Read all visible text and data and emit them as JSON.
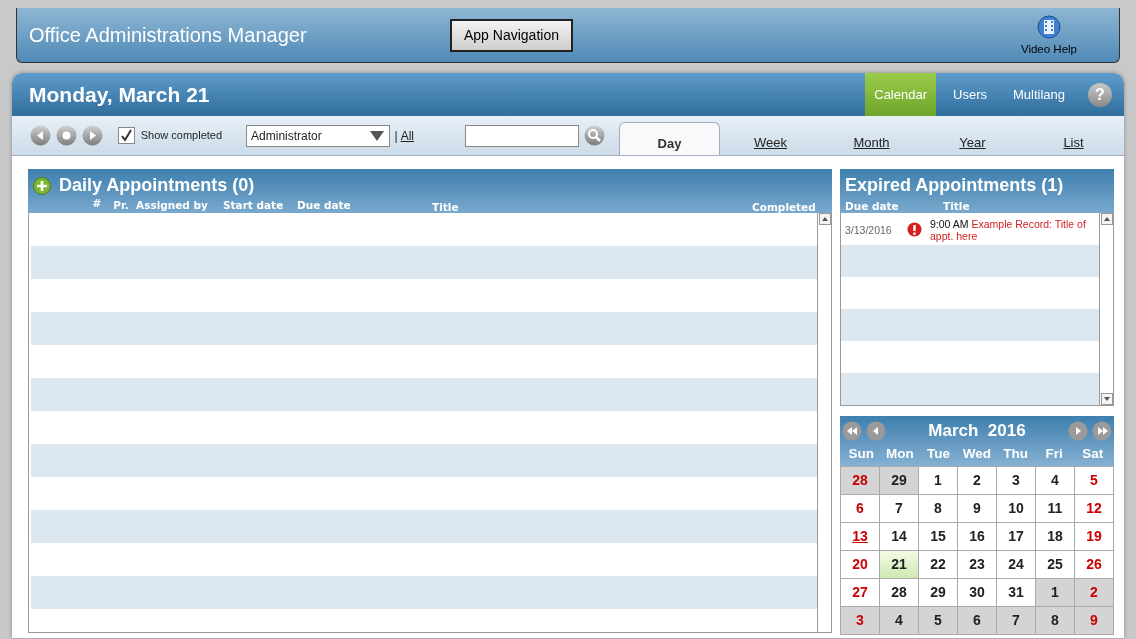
{
  "app": {
    "title": "Office Administrations Manager",
    "nav_button": "App Navigation",
    "video_help": "Video Help"
  },
  "header": {
    "date": "Monday, March 21",
    "help": "?",
    "nav": [
      {
        "label": "Calendar",
        "selected": true
      },
      {
        "label": "Users",
        "selected": false
      },
      {
        "label": "Multilang",
        "selected": false
      }
    ]
  },
  "toolbar": {
    "show_completed": {
      "label": "Show completed",
      "checked": true
    },
    "assignee": "Administrator",
    "separator": "|",
    "all_link": "All"
  },
  "view_tabs": [
    {
      "label": "Day",
      "selected": true
    },
    {
      "label": "Week",
      "selected": false
    },
    {
      "label": "Month",
      "selected": false
    },
    {
      "label": "Year",
      "selected": false
    },
    {
      "label": "List",
      "selected": false
    }
  ],
  "daily": {
    "title": "Daily Appointments (0)",
    "columns": [
      "#",
      "Pr.",
      "Assigned by",
      "Start date",
      "Due date",
      "Title",
      "Completed"
    ]
  },
  "expired": {
    "title": "Expired Appointments (1)",
    "columns": [
      "Due date",
      "Title"
    ],
    "rows": [
      {
        "due": "3/13/2016",
        "time": "9:00 AM",
        "title": "Example Record: Title of appt. here"
      }
    ]
  },
  "calendar": {
    "title": "March  2016",
    "weekdays": [
      "Sun",
      "Mon",
      "Tue",
      "Wed",
      "Thu",
      "Fri",
      "Sat"
    ],
    "weeks": [
      [
        {
          "day": "28",
          "outside": true,
          "selected": false,
          "event": false
        },
        {
          "day": "29",
          "outside": true,
          "selected": false,
          "event": false
        },
        {
          "day": "1",
          "outside": false,
          "selected": false,
          "event": false
        },
        {
          "day": "2",
          "outside": false,
          "selected": false,
          "event": false
        },
        {
          "day": "3",
          "outside": false,
          "selected": false,
          "event": false
        },
        {
          "day": "4",
          "outside": false,
          "selected": false,
          "event": false
        },
        {
          "day": "5",
          "outside": false,
          "selected": false,
          "event": false
        }
      ],
      [
        {
          "day": "6",
          "outside": false,
          "selected": false,
          "event": false
        },
        {
          "day": "7",
          "outside": false,
          "selected": false,
          "event": false
        },
        {
          "day": "8",
          "outside": false,
          "selected": false,
          "event": false
        },
        {
          "day": "9",
          "outside": false,
          "selected": false,
          "event": false
        },
        {
          "day": "10",
          "outside": false,
          "selected": false,
          "event": false
        },
        {
          "day": "11",
          "outside": false,
          "selected": false,
          "event": false
        },
        {
          "day": "12",
          "outside": false,
          "selected": false,
          "event": false
        }
      ],
      [
        {
          "day": "13",
          "outside": false,
          "selected": false,
          "event": true
        },
        {
          "day": "14",
          "outside": false,
          "selected": false,
          "event": false
        },
        {
          "day": "15",
          "outside": false,
          "selected": false,
          "event": false
        },
        {
          "day": "16",
          "outside": false,
          "selected": false,
          "event": false
        },
        {
          "day": "17",
          "outside": false,
          "selected": false,
          "event": false
        },
        {
          "day": "18",
          "outside": false,
          "selected": false,
          "event": false
        },
        {
          "day": "19",
          "outside": false,
          "selected": false,
          "event": false
        }
      ],
      [
        {
          "day": "20",
          "outside": false,
          "selected": false,
          "event": false
        },
        {
          "day": "21",
          "outside": false,
          "selected": true,
          "event": false
        },
        {
          "day": "22",
          "outside": false,
          "selected": false,
          "event": false
        },
        {
          "day": "23",
          "outside": false,
          "selected": false,
          "event": false
        },
        {
          "day": "24",
          "outside": false,
          "selected": false,
          "event": false
        },
        {
          "day": "25",
          "outside": false,
          "selected": false,
          "event": false
        },
        {
          "day": "26",
          "outside": false,
          "selected": false,
          "event": false
        }
      ],
      [
        {
          "day": "27",
          "outside": false,
          "selected": false,
          "event": false
        },
        {
          "day": "28",
          "outside": false,
          "selected": false,
          "event": false
        },
        {
          "day": "29",
          "outside": false,
          "selected": false,
          "event": false
        },
        {
          "day": "30",
          "outside": false,
          "selected": false,
          "event": false
        },
        {
          "day": "31",
          "outside": false,
          "selected": false,
          "event": false
        },
        {
          "day": "1",
          "outside": true,
          "selected": false,
          "event": false
        },
        {
          "day": "2",
          "outside": true,
          "selected": false,
          "event": false
        }
      ],
      [
        {
          "day": "3",
          "outside": true,
          "selected": false,
          "event": false
        },
        {
          "day": "4",
          "outside": true,
          "selected": false,
          "event": false
        },
        {
          "day": "5",
          "outside": true,
          "selected": false,
          "event": false
        },
        {
          "day": "6",
          "outside": true,
          "selected": false,
          "event": false
        },
        {
          "day": "7",
          "outside": true,
          "selected": false,
          "event": false
        },
        {
          "day": "8",
          "outside": true,
          "selected": false,
          "event": false
        },
        {
          "day": "9",
          "outside": true,
          "selected": false,
          "event": false
        }
      ]
    ]
  }
}
